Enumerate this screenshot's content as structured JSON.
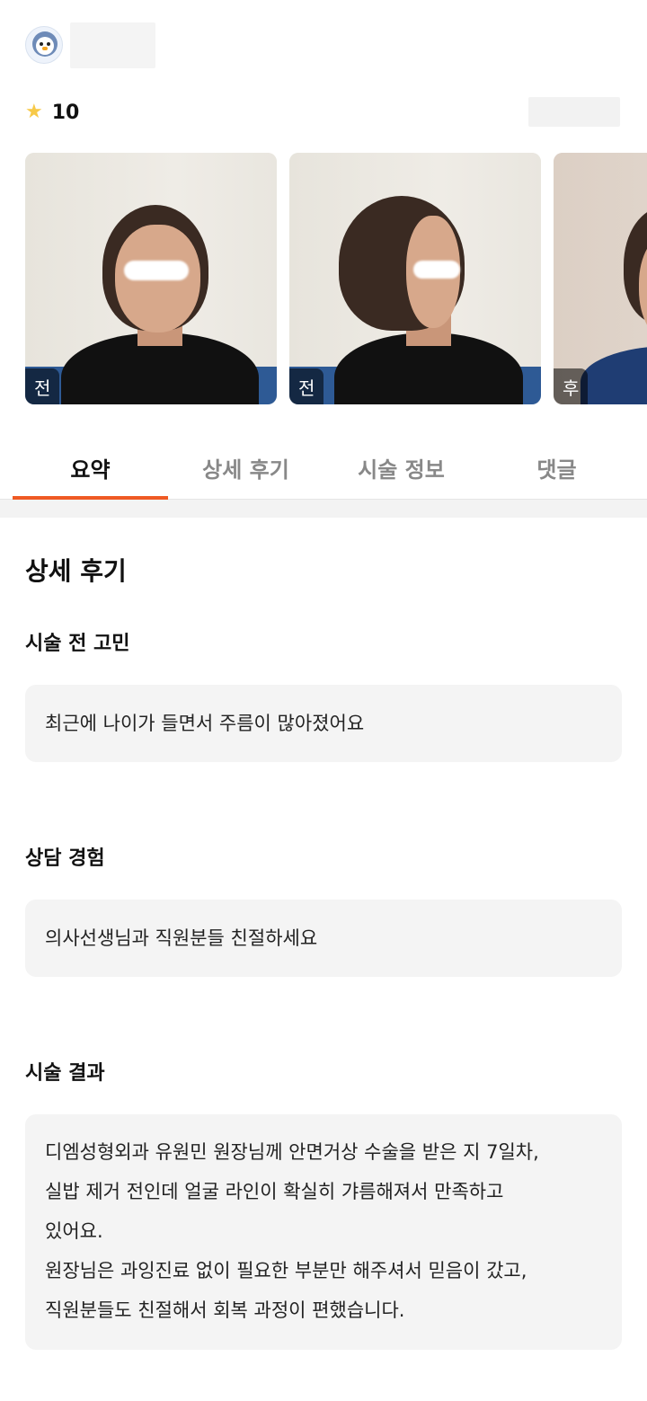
{
  "review": {
    "rating": "10",
    "photos": [
      {
        "badge": "전"
      },
      {
        "badge": "전"
      },
      {
        "badge": "후"
      }
    ]
  },
  "tabs": [
    "요약",
    "상세 후기",
    "시술 정보",
    "댓글"
  ],
  "detail": {
    "title": "상세 후기",
    "sections": [
      {
        "heading": "시술 전 고민",
        "text": "최근에 나이가 들면서 주름이 많아졌어요"
      },
      {
        "heading": "상담 경험",
        "text": "의사선생님과 직원분들 친절하세요"
      },
      {
        "heading": "시술 결과",
        "text": "디엠성형외과 유원민 원장님께 안면거상 수술을 받은 지 7일차,\n실밥 제거 전인데 얼굴 라인이 확실히 갸름해져서 만족하고\n있어요.\n원장님은 과잉진료 없이 필요한 부분만 해주셔서 믿음이 갔고,\n직원분들도 친절해서 회복 과정이 편했습니다."
      }
    ]
  },
  "colors": {
    "accent": "#ef5a24",
    "star": "#f7c948"
  },
  "icons": {
    "avatar": "penguin-avatar-icon",
    "rating": "star-icon"
  }
}
